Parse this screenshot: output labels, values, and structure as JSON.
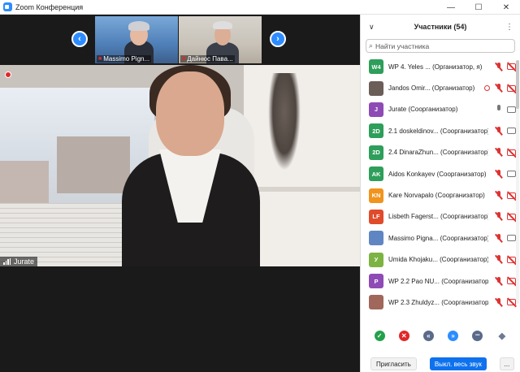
{
  "window": {
    "title": "Zoom Конференция",
    "controls": [
      "—",
      "☐",
      "✕"
    ]
  },
  "strip": {
    "prev_icon": "‹",
    "next_icon": "›",
    "thumbs": [
      {
        "name": "Massimo Pign..."
      },
      {
        "name": "Дайнюс Пава..."
      }
    ]
  },
  "main": {
    "speaker": "Jurate"
  },
  "panel": {
    "title": "Участники (54)",
    "collapse_icon": "∨",
    "more_icon": "⋮",
    "search_placeholder": "Найти участника",
    "participants": [
      {
        "initials": "W4",
        "color": "#2e9e5b",
        "name": "WP 4. Yeles ... (Организатор, я)",
        "mic": "off",
        "cam": "off"
      },
      {
        "initials": "",
        "color": "#6b5d57",
        "name": "Jandos Omir... (Организатор)",
        "mic": "off",
        "cam": "off",
        "rec": true
      },
      {
        "initials": "J",
        "color": "#8e4bb5",
        "name": "Jurate (Соорганизатор)",
        "mic": "on",
        "cam": "on"
      },
      {
        "initials": "2D",
        "color": "#2e9e5b",
        "name": "2.1 doskeldinov... (Соорганизатор)",
        "mic": "off",
        "cam": "on"
      },
      {
        "initials": "2D",
        "color": "#2e9e5b",
        "name": "2.4 DinaraZhun... (Соорганизатор)",
        "mic": "off",
        "cam": "off"
      },
      {
        "initials": "AK",
        "color": "#2e9e5b",
        "name": "Aidos Konkayev (Соорганизатор)",
        "mic": "off",
        "cam": "on"
      },
      {
        "initials": "KN",
        "color": "#f0941e",
        "name": "Kare Norvapalo (Соорганизатор)",
        "mic": "off",
        "cam": "off"
      },
      {
        "initials": "LF",
        "color": "#e04b2c",
        "name": "Lisbeth Fagerst... (Соорганизатор)",
        "mic": "off",
        "cam": "off"
      },
      {
        "initials": "",
        "color": "#5f86c2",
        "name": "Massimo Pigna... (Соорганизатор)",
        "mic": "off",
        "cam": "on"
      },
      {
        "initials": "У",
        "color": "#7cb342",
        "name": "Umida Khojaku... (Соорганизатор)",
        "mic": "off",
        "cam": "off"
      },
      {
        "initials": "P",
        "color": "#8e4bb5",
        "name": "WP 2.2 Pao NU... (Соорганизатор)",
        "mic": "off",
        "cam": "off"
      },
      {
        "initials": "",
        "color": "#a0675a",
        "name": "WP 2.3 Zhuldyz... (Соорганизатор)",
        "mic": "off",
        "cam": "off"
      }
    ],
    "reactions": [
      {
        "name": "yes",
        "glyph": "✓",
        "color": "#23a14a"
      },
      {
        "name": "no",
        "glyph": "✕",
        "color": "#e02828"
      },
      {
        "name": "slower",
        "glyph": "«",
        "color": "#5a6a8a"
      },
      {
        "name": "faster",
        "glyph": "»",
        "color": "#2d8cff"
      },
      {
        "name": "more",
        "glyph": "•••",
        "color": "#5a6a8a"
      },
      {
        "name": "coffee",
        "glyph": "◆",
        "color": "#6d7b93"
      }
    ],
    "invite_label": "Пригласить",
    "mute_all_label": "Выкл. весь звук",
    "footer_more": "..."
  }
}
